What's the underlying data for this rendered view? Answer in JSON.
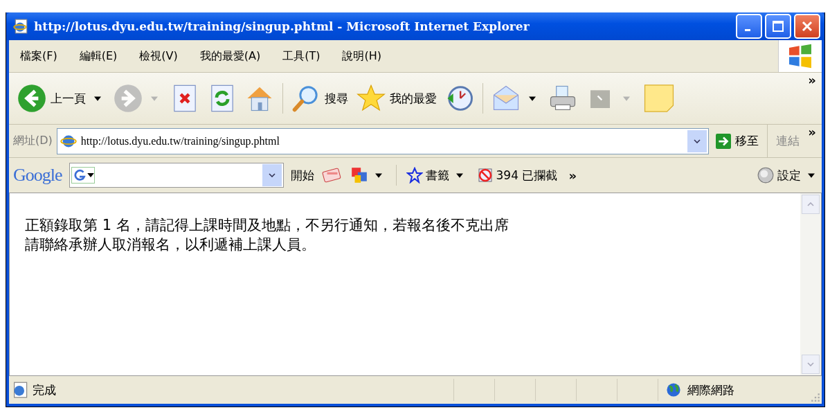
{
  "window": {
    "title": "http://lotus.dyu.edu.tw/training/singup.phtml - Microsoft Internet Explorer"
  },
  "menu": [
    "檔案(F)",
    "編輯(E)",
    "檢視(V)",
    "我的最愛(A)",
    "工具(T)",
    "說明(H)"
  ],
  "toolbar": [
    {
      "kind": "back",
      "label": "上一頁",
      "disabled": false
    },
    {
      "kind": "forward",
      "disabled": true
    },
    {
      "kind": "stop",
      "disabled": false
    },
    {
      "kind": "refresh",
      "disabled": false
    },
    {
      "kind": "home",
      "disabled": false
    },
    {
      "kind": "search",
      "label": "搜尋",
      "disabled": false
    },
    {
      "kind": "favorites",
      "label": "我的最愛",
      "disabled": false
    },
    {
      "kind": "history",
      "disabled": false
    },
    {
      "kind": "mail",
      "disabled": false
    },
    {
      "kind": "print",
      "disabled": false
    },
    {
      "kind": "edit",
      "disabled": true
    },
    {
      "kind": "note",
      "disabled": false
    }
  ],
  "toolbar_overflow": "»",
  "address": {
    "label": "網址(D)",
    "value": "http://lotus.dyu.edu.tw/training/singup.phtml",
    "go": "移至",
    "links": "連結",
    "overflow": "»"
  },
  "google_bar": {
    "logo": "Google",
    "search_button": "開始",
    "overflow": "»",
    "bookmarks": "書籤",
    "blocked": "394 已攔截",
    "settings": "設定"
  },
  "content": {
    "lines": [
      "正額錄取第 1 名，請記得上課時間及地點，不另行通知，若報名後不克出席",
      "請聯絡承辦人取消報名，以利遞補上課人員。"
    ]
  },
  "status_bar": {
    "text": "完成",
    "zone": "網際網路"
  }
}
